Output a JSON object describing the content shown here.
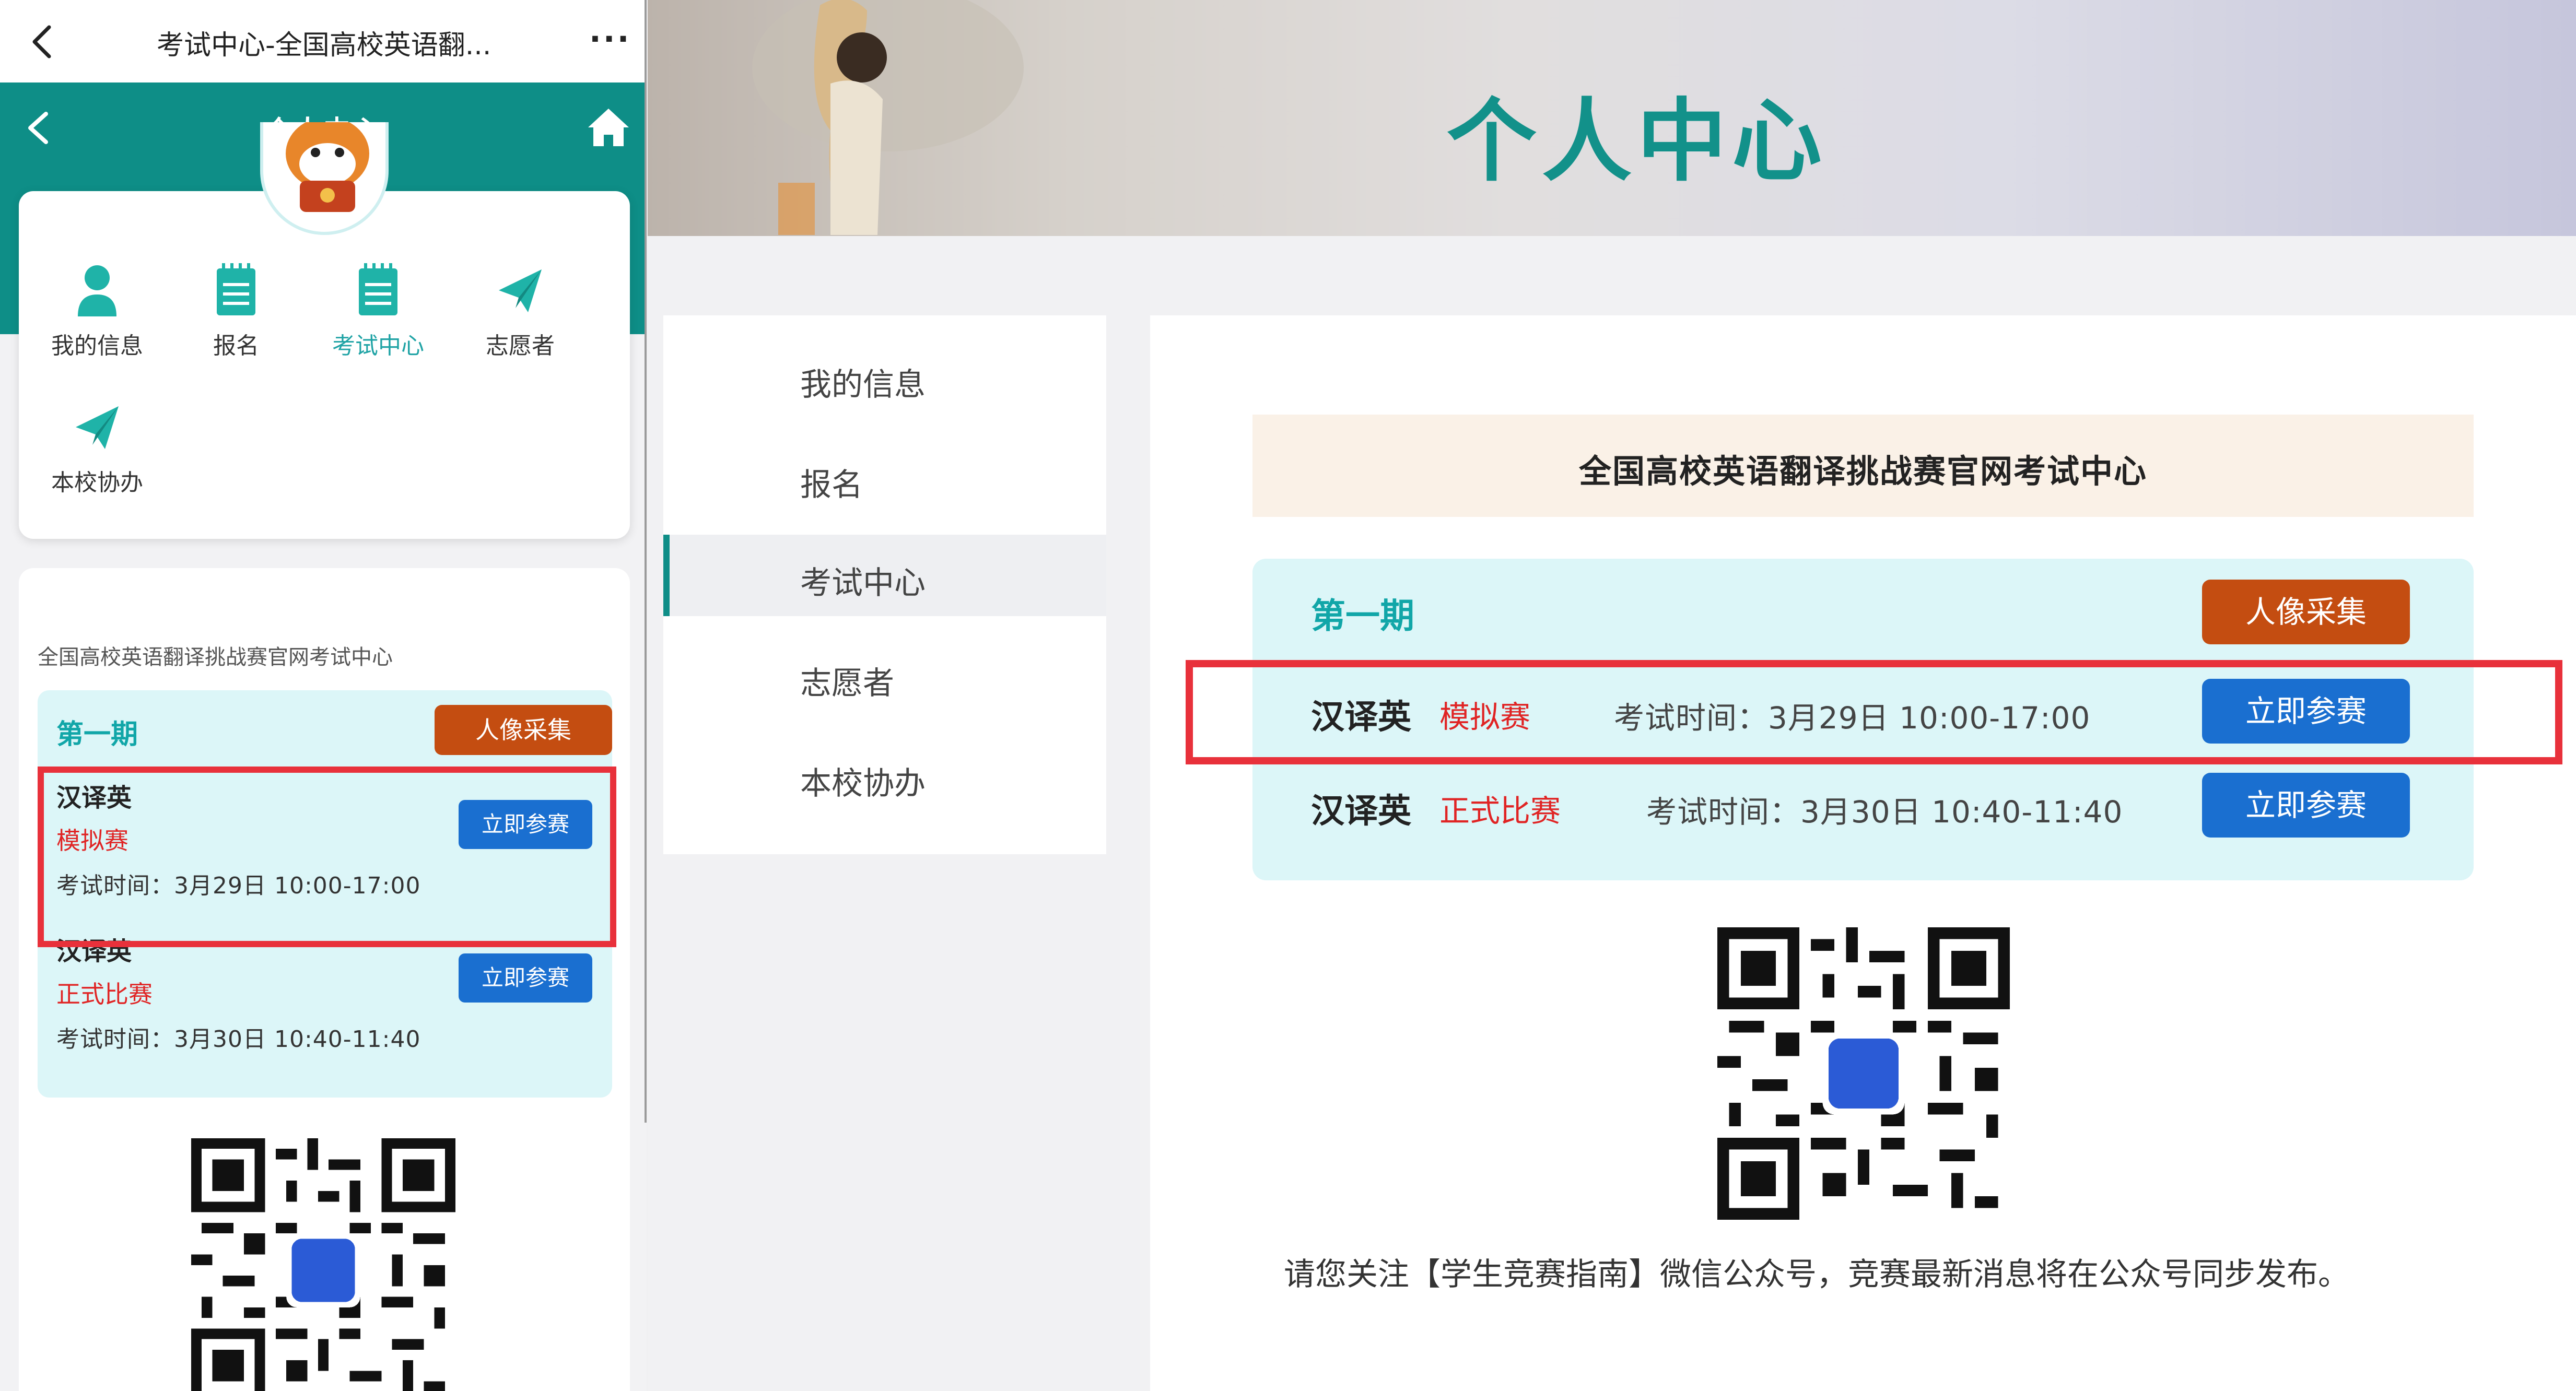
{
  "mobile": {
    "wechat_bar": {
      "title": "考试中心-全国高校英语翻...",
      "more_label": "···"
    },
    "header": {
      "title": "个人中心"
    },
    "menu": [
      {
        "label": "我的信息",
        "icon": "person-icon"
      },
      {
        "label": "报名",
        "icon": "notepad-icon"
      },
      {
        "label": "考试中心",
        "icon": "notepad-icon",
        "active": true
      },
      {
        "label": "志愿者",
        "icon": "paper-plane-icon"
      },
      {
        "label": "本校协办",
        "icon": "paper-plane-icon"
      }
    ],
    "exam_center": {
      "title": "全国高校英语翻译挑战赛官网考试中心",
      "period": "第一期",
      "photo_button": "人像采集",
      "exams": [
        {
          "name": "汉译英",
          "type": "模拟赛",
          "time": "考试时间：3月29日 10:00-17:00",
          "button": "立即参赛"
        },
        {
          "name": "汉译英",
          "type": "正式比赛",
          "time": "考试时间：3月30日 10:40-11:40",
          "button": "立即参赛"
        }
      ]
    }
  },
  "desktop": {
    "banner_title": "个人中心",
    "side_menu": [
      {
        "label": "我的信息"
      },
      {
        "label": "报名"
      },
      {
        "label": "考试中心",
        "active": true
      },
      {
        "label": "志愿者"
      },
      {
        "label": "本校协办"
      }
    ],
    "exam_center": {
      "title": "全国高校英语翻译挑战赛官网考试中心",
      "period": "第一期",
      "photo_button": "人像采集",
      "exams": [
        {
          "name": "汉译英",
          "type": "模拟赛",
          "time": "考试时间：3月29日 10:00-17:00",
          "button": "立即参赛"
        },
        {
          "name": "汉译英",
          "type": "正式比赛",
          "time": "考试时间：3月30日 10:40-11:40",
          "button": "立即参赛"
        }
      ]
    },
    "footer_note": "请您关注【学生竞赛指南】微信公众号，竞赛最新消息将在公众号同步发布。"
  },
  "colors": {
    "teal": "#0e8e87",
    "accent_teal_text": "#11a6a8",
    "photo_button": "#c44d11",
    "join_button": "#1a6fd0",
    "highlight": "#e8313b",
    "tag_red": "#e02424"
  }
}
